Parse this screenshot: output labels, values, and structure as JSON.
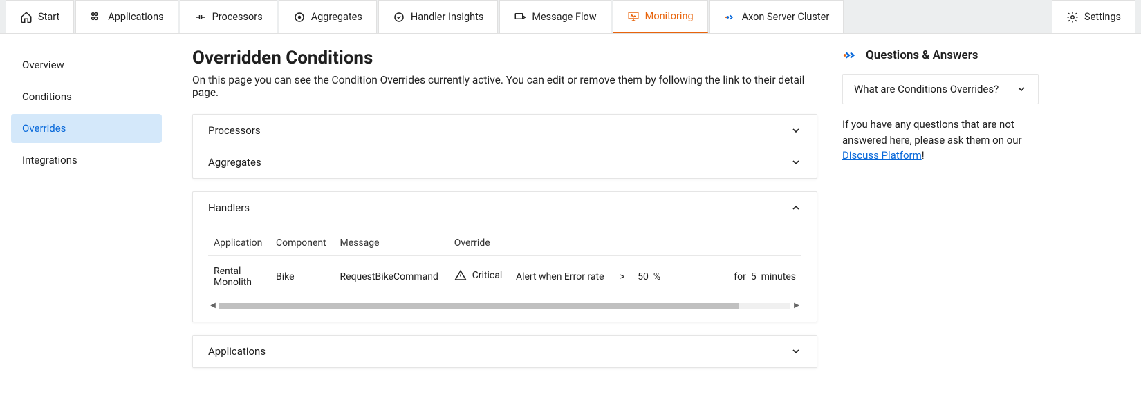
{
  "nav": {
    "tabs": [
      {
        "label": "Start",
        "icon": "home"
      },
      {
        "label": "Applications",
        "icon": "apps"
      },
      {
        "label": "Processors",
        "icon": "proc"
      },
      {
        "label": "Aggregates",
        "icon": "agg"
      },
      {
        "label": "Handler Insights",
        "icon": "insights"
      },
      {
        "label": "Message Flow",
        "icon": "flow"
      },
      {
        "label": "Monitoring",
        "icon": "monitor"
      },
      {
        "label": "Axon Server Cluster",
        "icon": "cluster"
      }
    ],
    "settings": "Settings"
  },
  "sidebar": {
    "items": [
      "Overview",
      "Conditions",
      "Overrides",
      "Integrations"
    ]
  },
  "page": {
    "title": "Overridden Conditions",
    "description": "On this page you can see the Condition Overrides currently active. You can edit or remove them by following the link to their detail page."
  },
  "sections": {
    "processors": "Processors",
    "aggregates": "Aggregates",
    "handlers": "Handlers",
    "applications": "Applications"
  },
  "handlers_table": {
    "headers": [
      "Application",
      "Component",
      "Message",
      "Override"
    ],
    "row": {
      "application": "Rental Monolith",
      "component": "Bike",
      "message": "RequestBikeCommand",
      "severity": "Critical",
      "alert_text": "Alert when Error rate",
      "operator": ">",
      "value": "50",
      "unit": "%",
      "for_label": "for",
      "duration": "5",
      "duration_unit": "minutes"
    }
  },
  "qa": {
    "title": "Questions & Answers",
    "item": "What are Conditions Overrides?",
    "footer_pre": "If you have any questions that are not answered here, please ask them on our ",
    "link": "Discuss Platform",
    "footer_post": "!"
  }
}
